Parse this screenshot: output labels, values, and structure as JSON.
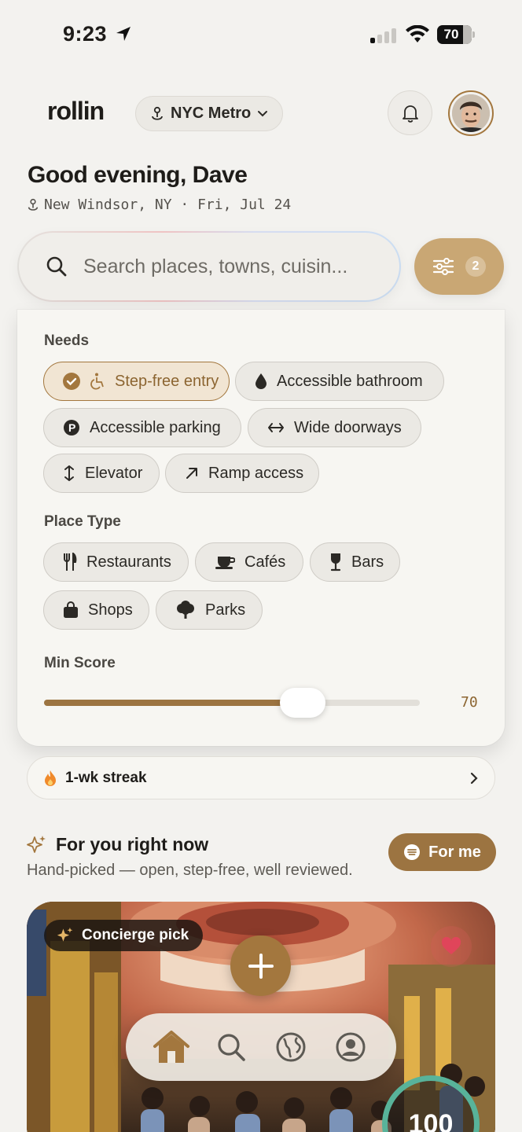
{
  "status_bar": {
    "time": "9:23",
    "battery": "70"
  },
  "header": {
    "logo": "rollin",
    "metro_label": "NYC Metro",
    "greeting": "Good evening, Dave",
    "location_line": "New Windsor, NY · Fri, Jul 24"
  },
  "search": {
    "placeholder": "Search places, towns, cuisin...",
    "filter_count": "2"
  },
  "filters": {
    "needs_label": "Needs",
    "needs": [
      {
        "label": "Step-free entry",
        "icon": "wheelchair-icon",
        "selected": true
      },
      {
        "label": "Accessible bathroom",
        "icon": "drop-icon",
        "selected": false
      },
      {
        "label": "Accessible parking",
        "icon": "parking-icon",
        "selected": false
      },
      {
        "label": "Wide doorways",
        "icon": "arrows-horizontal-icon",
        "selected": false
      },
      {
        "label": "Elevator",
        "icon": "arrows-vertical-icon",
        "selected": false
      },
      {
        "label": "Ramp access",
        "icon": "arrow-up-right-icon",
        "selected": false
      }
    ],
    "place_type_label": "Place Type",
    "place_types": [
      {
        "label": "Restaurants",
        "icon": "fork-knife-icon"
      },
      {
        "label": "Cafés",
        "icon": "coffee-cup-icon"
      },
      {
        "label": "Bars",
        "icon": "wine-glass-icon"
      },
      {
        "label": "Shops",
        "icon": "shopping-bag-icon"
      },
      {
        "label": "Parks",
        "icon": "tree-icon"
      }
    ],
    "min_score_label": "Min Score",
    "min_score": "70",
    "min_score_fraction": 0.7
  },
  "streak": {
    "label": "1-wk streak"
  },
  "for_you": {
    "title": "For you right now",
    "subtitle": "Hand-picked — open, step-free, well reviewed.",
    "for_me_label": "For me"
  },
  "card": {
    "tag": "Concierge pick",
    "score": "100"
  },
  "colors": {
    "accent": "#a3773e",
    "accent_dark": "#9c7441",
    "filter_btn": "#c9a774",
    "score_ring": "#58b39a"
  }
}
